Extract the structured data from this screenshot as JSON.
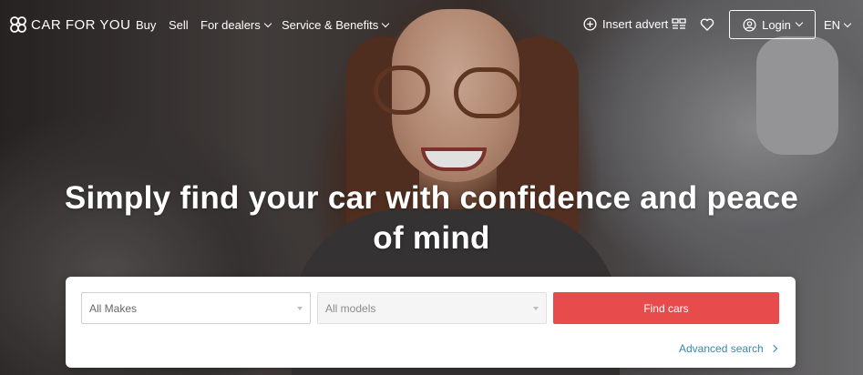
{
  "brand": {
    "name": "CAR FOR YOU"
  },
  "nav": {
    "buy": "Buy",
    "sell": "Sell",
    "for_dealers": "For dealers",
    "service_benefits": "Service & Benefits",
    "insert_advert": "Insert advert",
    "login": "Login",
    "language": "EN"
  },
  "hero": {
    "headline_line1": "Simply find your car with confidence and peace",
    "headline_line2": "of mind"
  },
  "search": {
    "makes_value": "All Makes",
    "models_value": "All models",
    "find_button": "Find cars",
    "advanced_search": "Advanced search"
  },
  "colors": {
    "accent": "#e84b4b",
    "link": "#3a87b3"
  }
}
